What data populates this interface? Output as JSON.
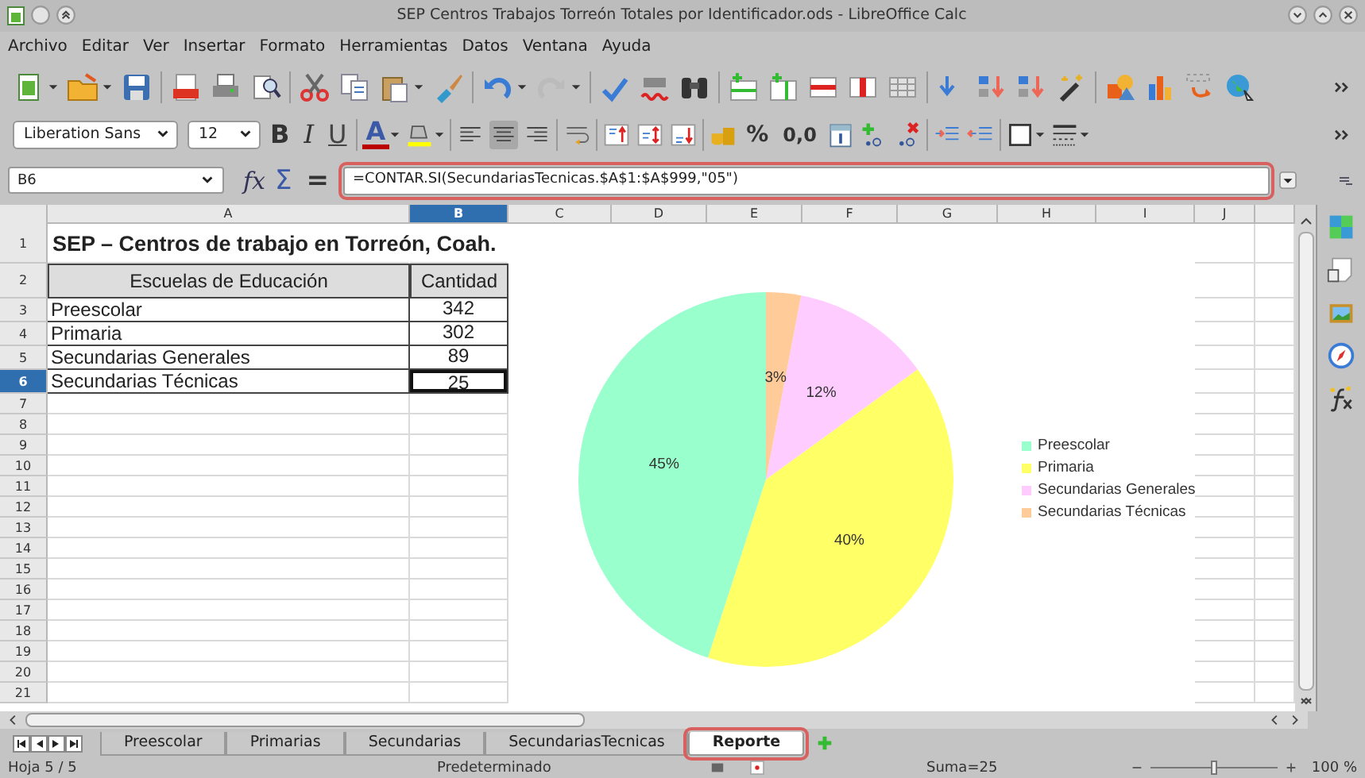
{
  "window": {
    "title": "SEP Centros Trabajos Torreón Totales por Identificador.ods - LibreOffice Calc"
  },
  "menu": [
    "Archivo",
    "Editar",
    "Ver",
    "Insertar",
    "Formato",
    "Herramientas",
    "Datos",
    "Ventana",
    "Ayuda"
  ],
  "format_toolbar": {
    "font": "Liberation Sans",
    "size": "12",
    "bold": "B",
    "italic": "I",
    "underline": "U",
    "font_color": "A",
    "percent": "%",
    "number": "0,0"
  },
  "formula_bar": {
    "name_box": "B6",
    "function_wizard": "fx",
    "sum": "Σ",
    "equals": "=",
    "formula": "=CONTAR.SI(SecundariasTecnicas.$A$1:$A$999,\"05\")",
    "highlighted": true
  },
  "columns": [
    {
      "label": "A",
      "selected": false
    },
    {
      "label": "B",
      "selected": true
    },
    {
      "label": "C",
      "selected": false
    },
    {
      "label": "D",
      "selected": false
    },
    {
      "label": "E",
      "selected": false
    },
    {
      "label": "F",
      "selected": false
    },
    {
      "label": "G",
      "selected": false
    },
    {
      "label": "H",
      "selected": false
    },
    {
      "label": "I",
      "selected": false
    },
    {
      "label": "J",
      "selected": false
    }
  ],
  "row_numbers": [
    {
      "label": "1",
      "selected": false
    },
    {
      "label": "2",
      "selected": false
    },
    {
      "label": "3",
      "selected": false
    },
    {
      "label": "4",
      "selected": false
    },
    {
      "label": "5",
      "selected": false
    },
    {
      "label": "6",
      "selected": true
    },
    {
      "label": "7",
      "selected": false
    },
    {
      "label": "8",
      "selected": false
    },
    {
      "label": "9",
      "selected": false
    },
    {
      "label": "10",
      "selected": false
    },
    {
      "label": "11",
      "selected": false
    },
    {
      "label": "12",
      "selected": false
    },
    {
      "label": "13",
      "selected": false
    },
    {
      "label": "14",
      "selected": false
    },
    {
      "label": "15",
      "selected": false
    },
    {
      "label": "16",
      "selected": false
    },
    {
      "label": "17",
      "selected": false
    },
    {
      "label": "18",
      "selected": false
    },
    {
      "label": "19",
      "selected": false
    },
    {
      "label": "20",
      "selected": false
    },
    {
      "label": "21",
      "selected": false
    }
  ],
  "sheet": {
    "title": "SEP – Centros de trabajo en Torreón, Coah.",
    "header": [
      "Escuelas de Educación",
      "Cantidad"
    ],
    "rows": [
      {
        "name": "Preescolar",
        "count": "342",
        "selected": false
      },
      {
        "name": "Primaria",
        "count": "302",
        "selected": false
      },
      {
        "name": "Secundarias Generales",
        "count": "89",
        "selected": false
      },
      {
        "name": "Secundarias Técnicas",
        "count": "25",
        "selected": true
      }
    ]
  },
  "chart": {
    "slices": [
      {
        "color": "#99ffcc"
      },
      {
        "color": "#ffff66"
      },
      {
        "color": "#ffccff"
      },
      {
        "color": "#ffcc99"
      }
    ],
    "chart_data": {
      "type": "pie",
      "categories": [
        "Preescolar",
        "Primaria",
        "Secundarias Generales",
        "Secundarias Técnicas"
      ],
      "series": [
        {
          "values": [
            45,
            40,
            12,
            3
          ]
        }
      ],
      "value_labels": [
        "45%",
        "40%",
        "12%",
        "3%"
      ],
      "legend": "right"
    }
  },
  "sheet_tabs": [
    {
      "label": "Preescolar",
      "selected": false,
      "highlighted": false
    },
    {
      "label": "Primarias",
      "selected": false,
      "highlighted": false
    },
    {
      "label": "Secundarias",
      "selected": false,
      "highlighted": false
    },
    {
      "label": "SecundariasTecnicas",
      "selected": false,
      "highlighted": false
    },
    {
      "label": "Reporte",
      "selected": true,
      "highlighted": true
    }
  ],
  "status_bar": {
    "sheet": "Hoja 5 / 5",
    "style": "Predeterminado",
    "sum": "Suma=25",
    "zoom": "100 %",
    "zoom_slider": {
      "level": 0.5
    }
  }
}
